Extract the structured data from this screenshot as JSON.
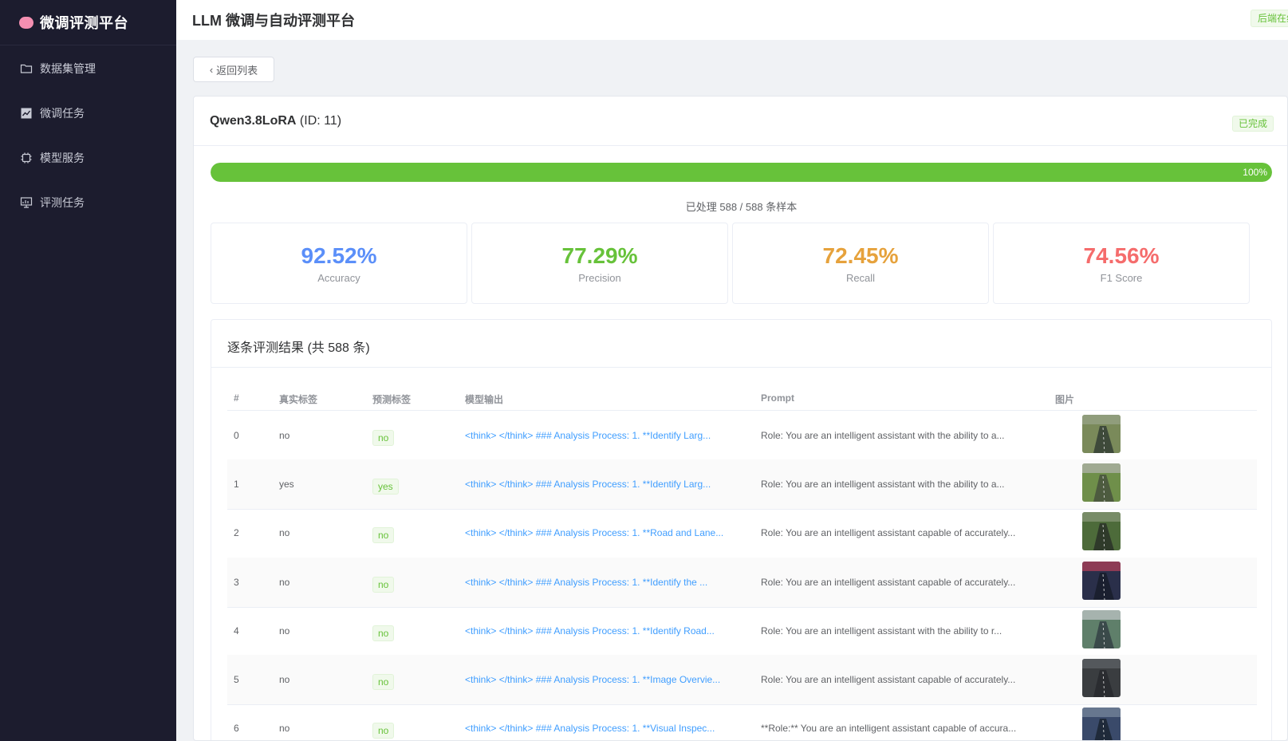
{
  "sidebar": {
    "brand": "微调评测平台",
    "items": [
      {
        "label": "数据集管理",
        "icon": "folder-icon"
      },
      {
        "label": "微调任务",
        "icon": "trend-chart-icon"
      },
      {
        "label": "模型服务",
        "icon": "cpu-icon"
      },
      {
        "label": "评测任务",
        "icon": "presentation-icon"
      }
    ]
  },
  "header": {
    "title": "LLM 微调与自动评测平台",
    "backend_status": "后端在线"
  },
  "back_button": "返回列表",
  "job": {
    "name": "Qwen3.8LoRA",
    "id_text": "(ID: 11)",
    "status": "已完成",
    "progress": 100,
    "progress_text": "100%",
    "processed_text": "已处理 588 / 588 条样本"
  },
  "metrics": [
    {
      "value": "92.52%",
      "label": "Accuracy",
      "color": "#5b8ff9"
    },
    {
      "value": "77.29%",
      "label": "Precision",
      "color": "#67c23a"
    },
    {
      "value": "72.45%",
      "label": "Recall",
      "color": "#e6a23c"
    },
    {
      "value": "74.56%",
      "label": "F1 Score",
      "color": "#f56c6c"
    }
  ],
  "results": {
    "title": "逐条评测结果 (共 588 条)",
    "columns": [
      "#",
      "真实标签",
      "预测标签",
      "模型输出",
      "Prompt",
      "图片"
    ],
    "rows": [
      {
        "index": "0",
        "truth": "no",
        "pred": "no",
        "output": "<think> </think> ### Analysis Process: 1. **Identify Larg...",
        "prompt": "Role: You are an intelligent assistant with the ability to a..."
      },
      {
        "index": "1",
        "truth": "yes",
        "pred": "yes",
        "output": "<think> </think> ### Analysis Process: 1. **Identify Larg...",
        "prompt": "Role: You are an intelligent assistant with the ability to a..."
      },
      {
        "index": "2",
        "truth": "no",
        "pred": "no",
        "output": "<think> </think> ### Analysis Process: 1. **Road and Lane...",
        "prompt": "Role: You are an intelligent assistant capable of accurately..."
      },
      {
        "index": "3",
        "truth": "no",
        "pred": "no",
        "output": "<think> </think> ### Analysis Process: 1. **Identify the ...",
        "prompt": "Role: You are an intelligent assistant capable of accurately..."
      },
      {
        "index": "4",
        "truth": "no",
        "pred": "no",
        "output": "<think> </think> ### Analysis Process: 1. **Identify Road...",
        "prompt": "Role: You are an intelligent assistant with the ability to r..."
      },
      {
        "index": "5",
        "truth": "no",
        "pred": "no",
        "output": "<think> </think> ### Analysis Process: 1. **Image Overvie...",
        "prompt": "Role: You are an intelligent assistant capable of accurately..."
      },
      {
        "index": "6",
        "truth": "no",
        "pred": "no",
        "output": "<think> </think> ### Analysis Process: 1. **Visual Inspec...",
        "prompt": "**Role:** You are an intelligent assistant capable of accura..."
      }
    ]
  }
}
